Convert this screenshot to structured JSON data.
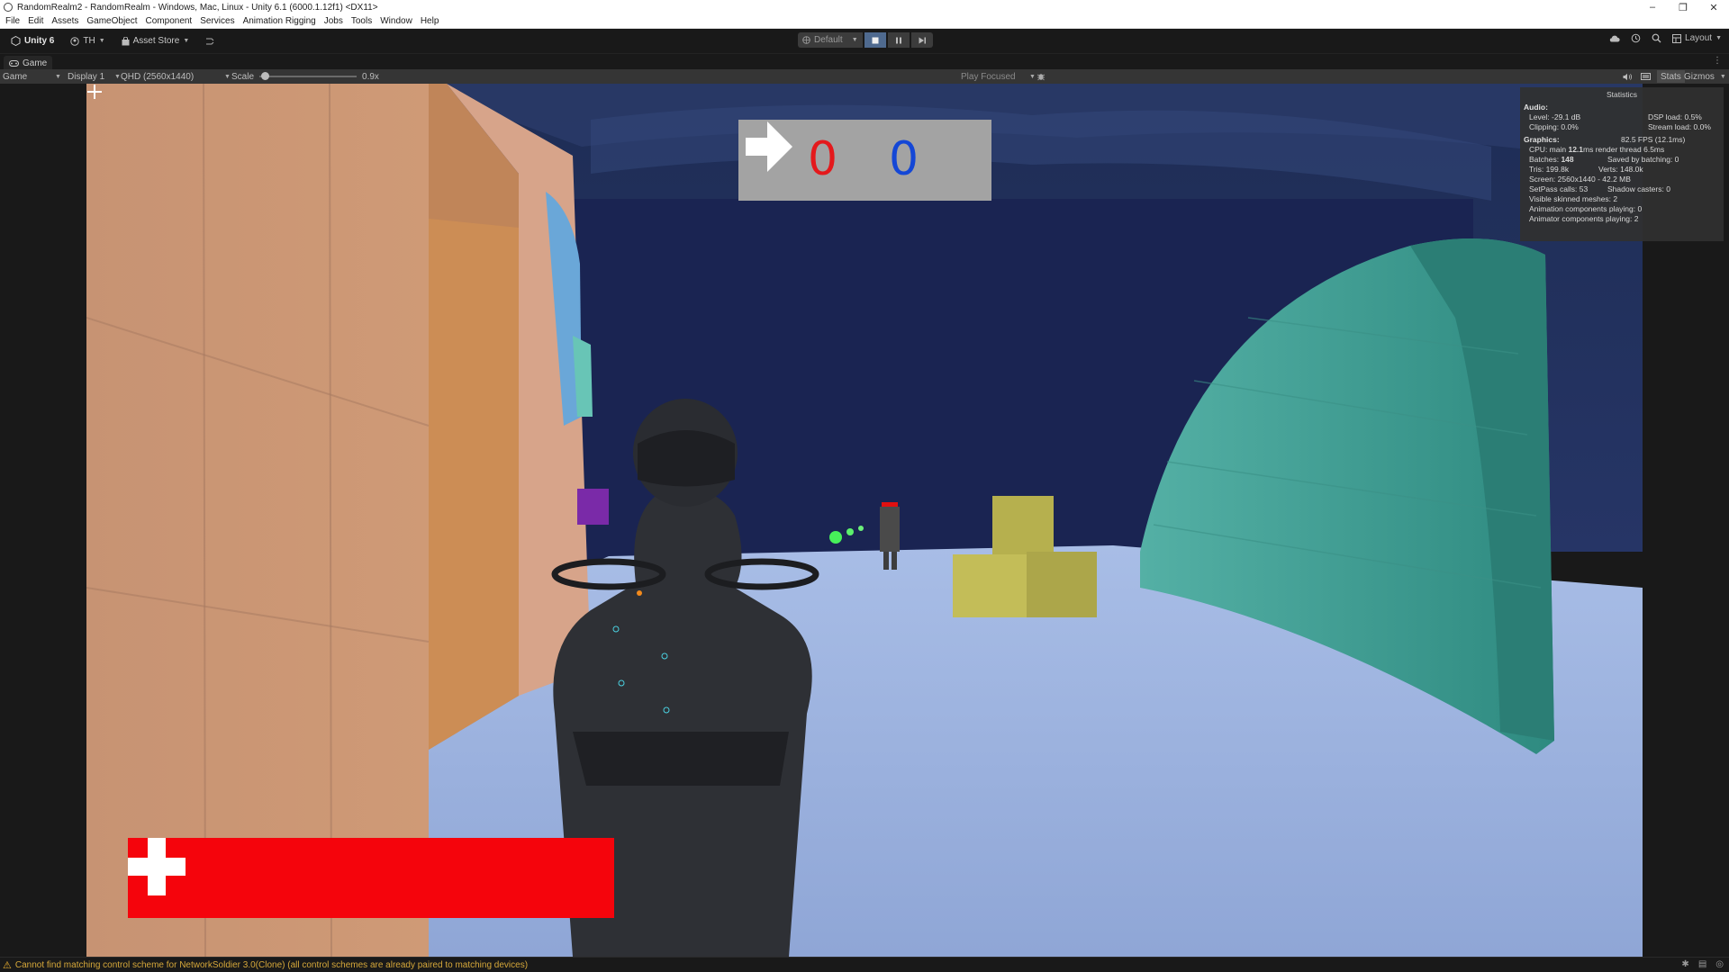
{
  "window": {
    "title": "RandomRealm2 - RandomRealm - Windows, Mac, Linux - Unity 6.1 (6000.1.12f1) <DX11>",
    "controls": {
      "minimize": "–",
      "restore": "❐",
      "close": "✕"
    }
  },
  "menu": [
    "File",
    "Edit",
    "Assets",
    "GameObject",
    "Component",
    "Services",
    "Animation Rigging",
    "Jobs",
    "Tools",
    "Window",
    "Help"
  ],
  "toolbar": {
    "unity_label": "Unity 6",
    "account_label": "TH",
    "asset_store_label": "Asset Store",
    "profile_label": "Default",
    "play_icon": "stop-square-icon",
    "pause_icon": "pause-icon",
    "step_icon": "step-forward-icon",
    "layout_label": "Layout"
  },
  "tab": {
    "label": "Game"
  },
  "game_toolbar": {
    "mode": "Game",
    "display": "Display 1",
    "resolution": "QHD (2560x1440)",
    "scale_label": "Scale",
    "scale_value": "0.9x",
    "scale_fraction": 0.05,
    "play_focused": "Play Focused",
    "stats_label": "Stats",
    "gizmos_label": "Gizmos"
  },
  "hud": {
    "red_score": "0",
    "blue_score": "0",
    "red_color": "#e4191c",
    "blue_color": "#1447d6",
    "health_color": "#f5040c",
    "health_fraction": 1.0
  },
  "stats": {
    "title": "Statistics",
    "audio_header": "Audio:",
    "level": "Level: -29.1 dB",
    "dsp_load": "DSP load: 0.5%",
    "clipping": "Clipping: 0.0%",
    "stream_load": "Stream load: 0.0%",
    "graphics_header": "Graphics:",
    "fps": "82.5 FPS (12.1ms)",
    "cpu_prefix": "CPU: main",
    "cpu_main": "12.1",
    "cpu_suffix": "ms  render thread 6.5ms",
    "batches_prefix": "Batches:",
    "batches_value": "148",
    "saved_batching": "Saved by batching: 0",
    "tris": "Tris: 199.8k",
    "verts": "Verts: 148.0k",
    "screen": "Screen: 2560x1440 - 42.2 MB",
    "setpass": "SetPass calls: 53",
    "shadow_casters": "Shadow casters: 0",
    "skinned_meshes": "Visible skinned meshes: 2",
    "animation_components": "Animation components playing: 0",
    "animator_components": "Animator components playing: 2"
  },
  "status": {
    "message": "Cannot find matching control scheme for NetworkSoldier 3.0(Clone) (all control schemes are already paired to matching devices)"
  }
}
